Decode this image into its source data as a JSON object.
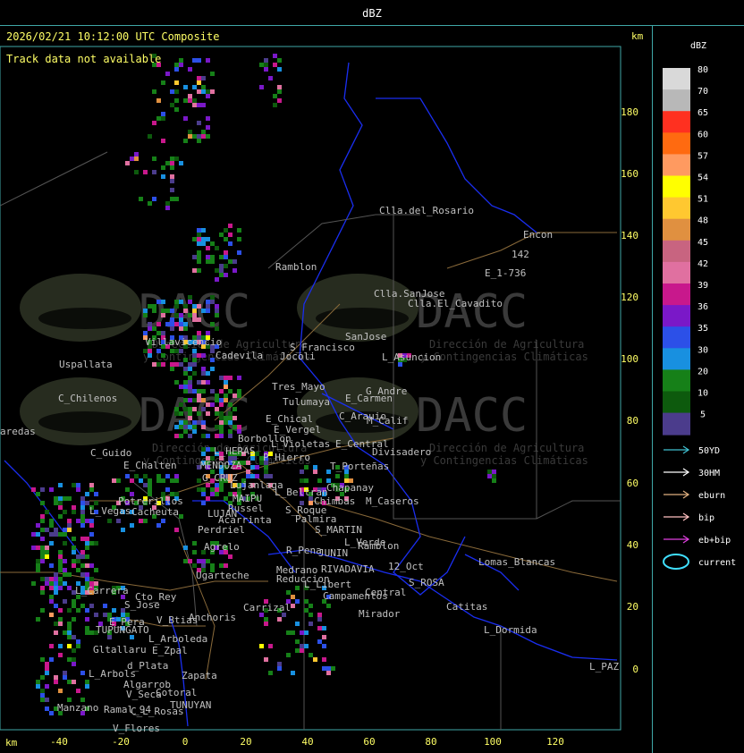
{
  "window": {
    "title": "dBZ"
  },
  "header": {
    "timestamp": "2026/02/21 10:12:00 UTC Composite",
    "note": "Track data not available",
    "km_label_top": "km",
    "km_label_bottom": "km"
  },
  "watermark": {
    "logo_text": "DACC",
    "line1": "Dirección de Agricultura",
    "line2": "y Contingencias Climáticas"
  },
  "axes": {
    "x_ticks": [
      "-40",
      "-20",
      "0",
      "20",
      "40",
      "60",
      "80",
      "100",
      "120"
    ],
    "y_ticks": [
      "180",
      "160",
      "140",
      "120",
      "100",
      "80",
      "60",
      "40",
      "20",
      "0"
    ]
  },
  "legend": {
    "title": "dBZ",
    "scale": [
      {
        "label": "80",
        "color": "#d9d9d9"
      },
      {
        "label": "70",
        "color": "#b8b8b8"
      },
      {
        "label": "65",
        "color": "#ff3020"
      },
      {
        "label": "60",
        "color": "#ff6a10"
      },
      {
        "label": "57",
        "color": "#ff9a60"
      },
      {
        "label": "54",
        "color": "#ffff00"
      },
      {
        "label": "51",
        "color": "#ffc830"
      },
      {
        "label": "48",
        "color": "#e09040"
      },
      {
        "label": "45",
        "color": "#c86480"
      },
      {
        "label": "42",
        "color": "#e070a0"
      },
      {
        "label": "39",
        "color": "#c8188c"
      },
      {
        "label": "36",
        "color": "#7a18c8"
      },
      {
        "label": "35",
        "color": "#2c50e8"
      },
      {
        "label": "30",
        "color": "#1890e0"
      },
      {
        "label": "20",
        "color": "#168018"
      },
      {
        "label": "10",
        "color": "#0d5a0d"
      },
      {
        "label": "5",
        "color": "#4b3c8c"
      }
    ],
    "tracks": [
      {
        "label": "50YD",
        "color": "#40c0d0"
      },
      {
        "label": "30HM",
        "color": "#ffffff"
      },
      {
        "label": "eburn",
        "color": "#e0b080"
      },
      {
        "label": "bip",
        "color": "#ffc0c0"
      },
      {
        "label": "eb+bip",
        "color": "#e040e0"
      },
      {
        "label": "current",
        "color": "#40e0ff"
      }
    ]
  },
  "places": [
    {
      "name": "Clla.del_Rosario"
    },
    {
      "name": "Encon"
    },
    {
      "name": "142"
    },
    {
      "name": "E_1-736"
    },
    {
      "name": "Ramblon"
    },
    {
      "name": "Clla.SanJose"
    },
    {
      "name": "Clla.El_Cavadito"
    },
    {
      "name": "S_Francisco"
    },
    {
      "name": "SanJose"
    },
    {
      "name": "L_Asuncion"
    },
    {
      "name": "Villavicencio"
    },
    {
      "name": "Jocoli"
    },
    {
      "name": "Uspallata"
    },
    {
      "name": "Cadevila"
    },
    {
      "name": "Tres_Mayo"
    },
    {
      "name": "G_Andre"
    },
    {
      "name": "Tulumaya"
    },
    {
      "name": "E_Carmen"
    },
    {
      "name": "C_Chilenos"
    },
    {
      "name": "E_Chical"
    },
    {
      "name": "C_Arauio"
    },
    {
      "name": "E_Vergel"
    },
    {
      "name": "M_Calif"
    },
    {
      "name": "Borbollon"
    },
    {
      "name": "L_Violetas"
    },
    {
      "name": "E_Central"
    },
    {
      "name": "aredas"
    },
    {
      "name": "C_Guido"
    },
    {
      "name": "L_HERAS"
    },
    {
      "name": "P_Hierro"
    },
    {
      "name": "Divisadero"
    },
    {
      "name": "E_Chalten"
    },
    {
      "name": "MENDOZA"
    },
    {
      "name": "T_Porteñas"
    },
    {
      "name": "G_CRUZ"
    },
    {
      "name": "Chapanay"
    },
    {
      "name": "Lujanlaga"
    },
    {
      "name": "L_Beltran"
    },
    {
      "name": "MAIPU"
    },
    {
      "name": "Chimbas"
    },
    {
      "name": "M_Caseros"
    },
    {
      "name": "Potrerillos"
    },
    {
      "name": "Cacheuta"
    },
    {
      "name": "L_Vegas"
    },
    {
      "name": "LUJAN"
    },
    {
      "name": "Russel"
    },
    {
      "name": "S_Roque"
    },
    {
      "name": "Palmira"
    },
    {
      "name": "Perdriel"
    },
    {
      "name": "Acarrinta"
    },
    {
      "name": "S_MARTIN"
    },
    {
      "name": "Agrelo"
    },
    {
      "name": "Ramblon"
    },
    {
      "name": "L_Verde"
    },
    {
      "name": "R_Pena"
    },
    {
      "name": "JUNIN"
    },
    {
      "name": "Lomas_Blancas"
    },
    {
      "name": "12_Oct"
    },
    {
      "name": "Medrano"
    },
    {
      "name": "RIVADAVIA"
    },
    {
      "name": "Ugarteche"
    },
    {
      "name": "Reduccion"
    },
    {
      "name": "L_Libert"
    },
    {
      "name": "Campamentos"
    },
    {
      "name": "S_ROSA"
    },
    {
      "name": "L_Carrera"
    },
    {
      "name": "Cto_Rey"
    },
    {
      "name": "S_Jose"
    },
    {
      "name": "Carrizal"
    },
    {
      "name": "Central"
    },
    {
      "name": "Catitas"
    },
    {
      "name": "E_Pera"
    },
    {
      "name": "V_Btias"
    },
    {
      "name": "Anchoris"
    },
    {
      "name": "TUPUNGATO"
    },
    {
      "name": "Mirador"
    },
    {
      "name": "L_Dormida"
    },
    {
      "name": "L_Arboleda"
    },
    {
      "name": "Gltallaru"
    },
    {
      "name": "E_Zpal"
    },
    {
      "name": "L_Arbols"
    },
    {
      "name": "d_Plata"
    },
    {
      "name": "Zapata"
    },
    {
      "name": "L_PAZ"
    },
    {
      "name": "Algarrob"
    },
    {
      "name": "V_Seca"
    },
    {
      "name": "Cotoral"
    },
    {
      "name": "TUNUYAN"
    },
    {
      "name": "Manzano"
    },
    {
      "name": "C_L_Rosas"
    },
    {
      "name": "V_Flores"
    },
    {
      "name": "Ramal_94"
    }
  ]
}
